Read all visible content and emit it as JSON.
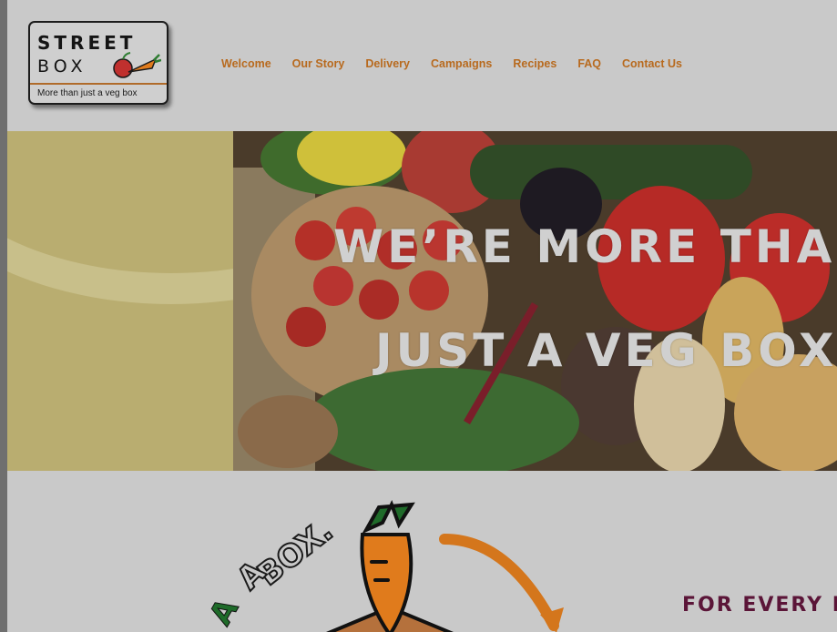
{
  "logo": {
    "line1": "STREET",
    "line2": "BOX",
    "tagline": "More than just a veg box"
  },
  "nav": {
    "items": [
      "Welcome",
      "Our Story",
      "Delivery",
      "Campaigns",
      "Recipes",
      "FAQ",
      "Contact Us"
    ]
  },
  "hero": {
    "line1": "WE’RE MORE THAN",
    "line2": "JUST A VEG BOX"
  },
  "section": {
    "art_text_1": "BOX.",
    "art_text_2": "A",
    "art_text_3": "A",
    "heading": "FOR EVERY B"
  },
  "colors": {
    "nav_text": "#b86a1e",
    "heading": "#5b1538",
    "hero_left": "#b9ad70",
    "background": "#c9c9c9"
  }
}
